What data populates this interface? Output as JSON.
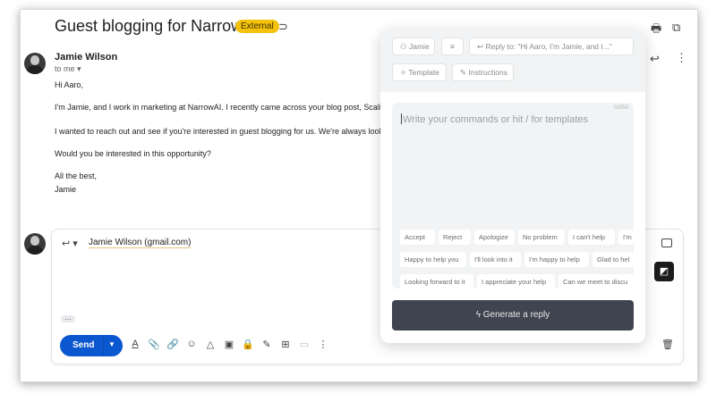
{
  "email": {
    "subject": "Guest blogging for NarrowAI?",
    "badge": "External",
    "sender": "Jamie Wilson",
    "to": "to me",
    "body": [
      "Hi Aaro,",
      "I'm Jamie, and I work in marketing at NarrowAI. I recently came across your blog post, Scaling S",
      "I wanted to reach out and see if you're interested in guest blogging for us. We're always looking",
      "Would you be interested in this opportunity?",
      "All the best,",
      "Jamie"
    ]
  },
  "compose": {
    "recipient": "Jamie Wilson (gmail.com)",
    "send_label": "Send"
  },
  "panel": {
    "sender_chip": "Jamie",
    "reply_chip": "Reply to: \"Hi Aaro, I'm Jamie, and I...\"",
    "template_chip": "Template",
    "instructions_chip": "Instructions",
    "placeholder": "Write your commands or hit / for templates",
    "counter": "0/250",
    "templates_row1": [
      "Accept",
      "Reject",
      "Apologize",
      "No problem",
      "I can't help",
      "I'm"
    ],
    "templates_row2": [
      "Happy to help you",
      "I'll look into it",
      "I'm happy to help",
      "Glad to hel"
    ],
    "templates_row3": [
      "Looking forward to it",
      "I appreciate your help",
      "Can we meet to discu"
    ],
    "generate_label": "Generate a reply"
  },
  "colors": {
    "badge": "#f4c20d",
    "send": "#0b57d0",
    "generate": "#3f4450"
  }
}
